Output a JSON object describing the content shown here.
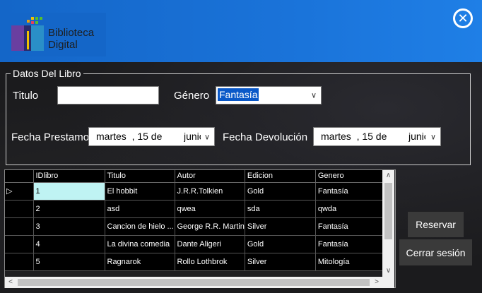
{
  "header": {
    "logo_line1": "Biblioteca",
    "logo_line2": "Digital",
    "close_icon": "close-circle-icon"
  },
  "form": {
    "group_title": "Datos Del Libro",
    "titulo_label": "Titulo",
    "titulo_value": "",
    "genero_label": "Género",
    "genero_value": "Fantasía",
    "fecha_prestamo_label": "Fecha Prestamo",
    "fecha_prestamo_value": "martes  , 15 de",
    "fecha_prestamo_month": "junio",
    "fecha_devolucion_label": "Fecha Devolución",
    "fecha_devolucion_value": "martes  , 15 de",
    "fecha_devolucion_month": "junio"
  },
  "grid": {
    "columns": [
      "IDlibro",
      "Titulo",
      "Autor",
      "Edicion",
      "Genero"
    ],
    "rows": [
      [
        "1",
        "El hobbit",
        "J.R.R.Tolkien",
        "Gold",
        "Fantasía"
      ],
      [
        "2",
        "asd",
        "qwea",
        "sda",
        "qwda"
      ],
      [
        "3",
        "Cancion de hielo ...",
        "George R.R. Martin",
        "Silver",
        "Fantasía"
      ],
      [
        "4",
        "La divina comedia",
        "Dante Aligeri",
        "Gold",
        "Fantasía"
      ],
      [
        "5",
        "Ragnarok",
        "Rollo Lothbrok",
        "Silver",
        "Mitología"
      ]
    ],
    "selected_row_marker": "▷"
  },
  "actions": {
    "reservar": "Reservar",
    "cerrar_sesion": "Cerrar sesión"
  },
  "colors": {
    "header": "#1a73d9",
    "selection": "#0a58c8",
    "selected_cell": "#bff3f3"
  }
}
